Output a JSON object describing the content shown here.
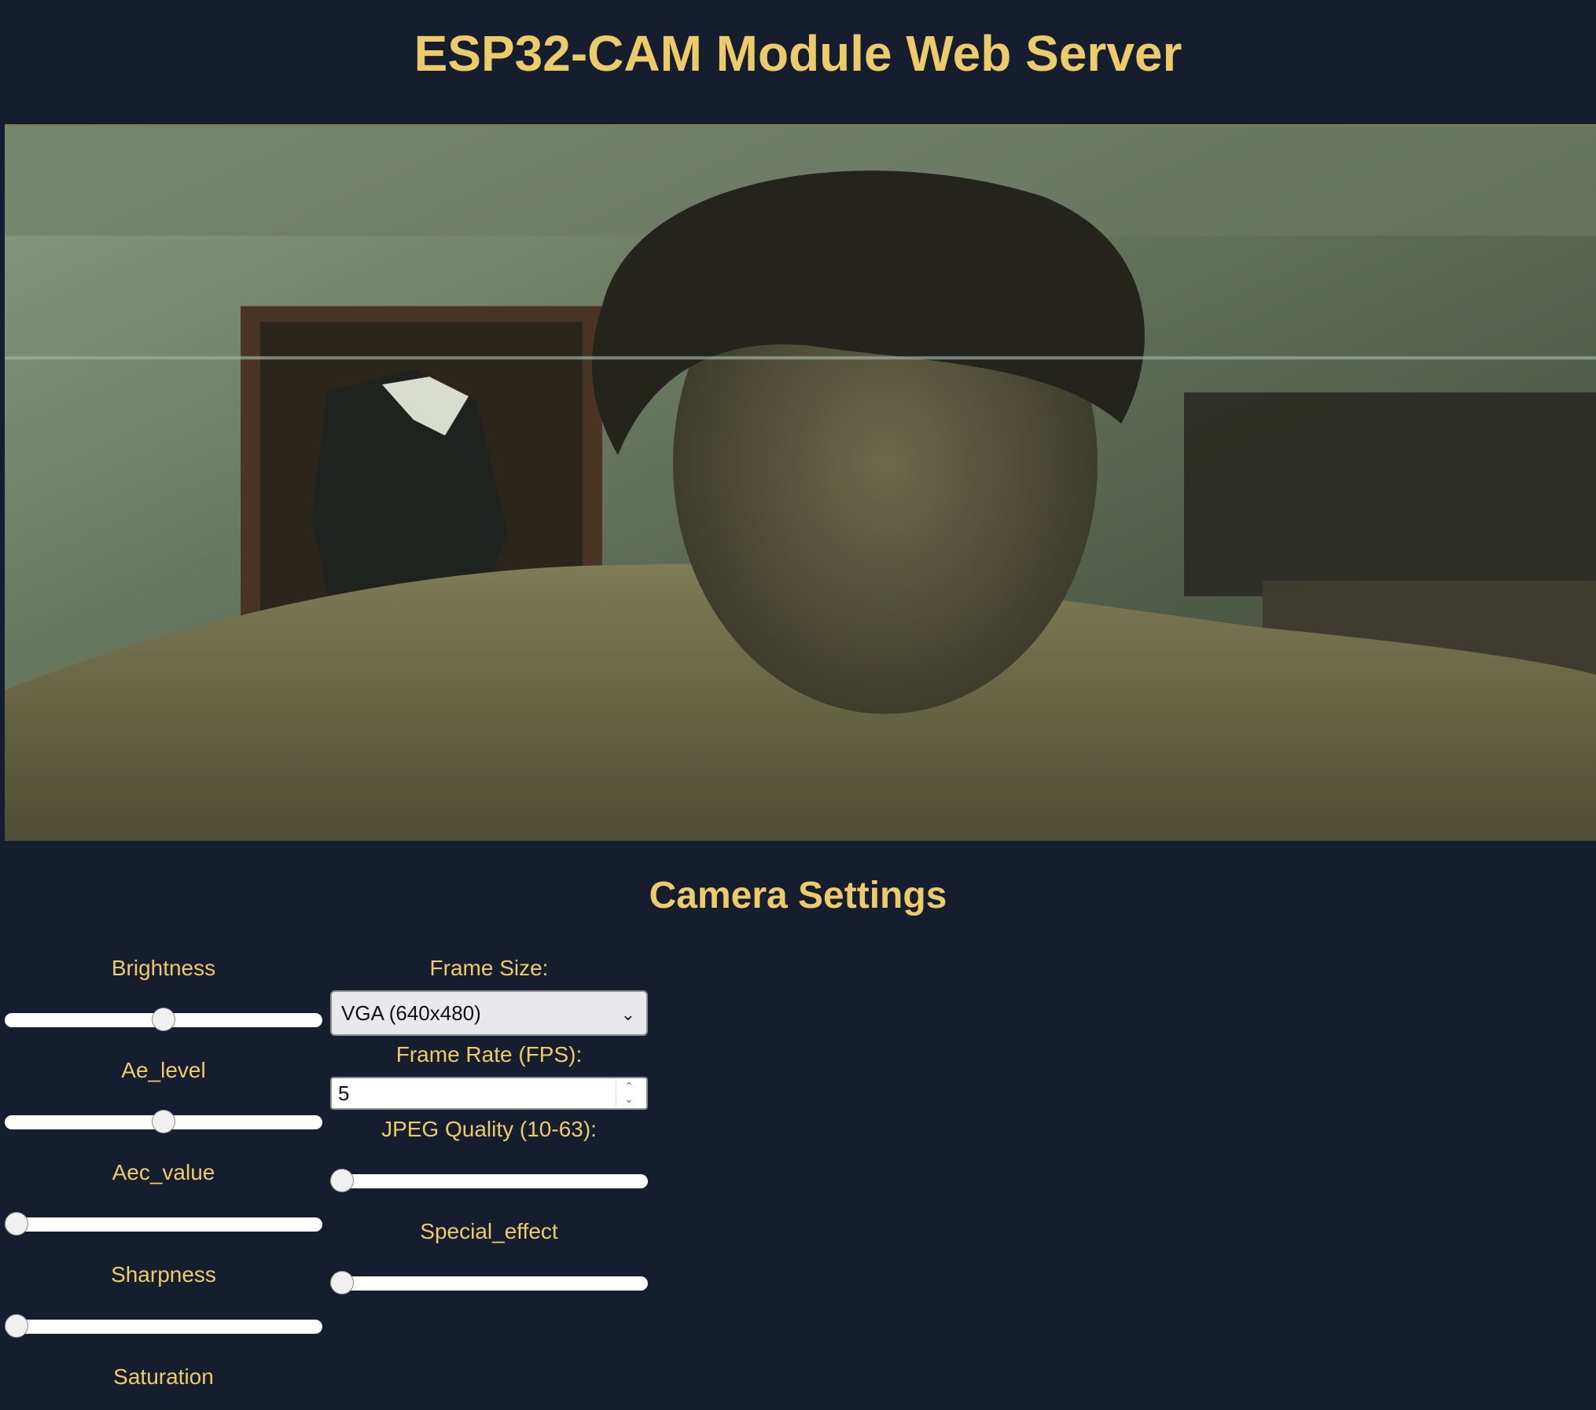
{
  "header": {
    "title": "ESP32-CAM Module Web Server"
  },
  "stream": {
    "image_name": "camera-stream"
  },
  "settings": {
    "title": "Camera Settings",
    "sliders": [
      {
        "label": "Brightness",
        "value_fraction": 0.5
      },
      {
        "label": "Ae_level",
        "value_fraction": 0.5
      },
      {
        "label": "Aec_value",
        "value_fraction": 0.0
      },
      {
        "label": "Sharpness",
        "value_fraction": 0.0
      },
      {
        "label": "Saturation"
      },
      {
        "label": "JPEG Quality (10-63):",
        "value_fraction": 0.0
      },
      {
        "label": "Special_effect",
        "value_fraction": 0.0
      }
    ],
    "frame_size": {
      "label": "Frame Size:",
      "selected": "VGA (640x480)"
    },
    "frame_rate": {
      "label": "Frame Rate (FPS):",
      "value": "5"
    }
  },
  "colors": {
    "background": "#161d2f",
    "accent": "#eccc6a"
  }
}
